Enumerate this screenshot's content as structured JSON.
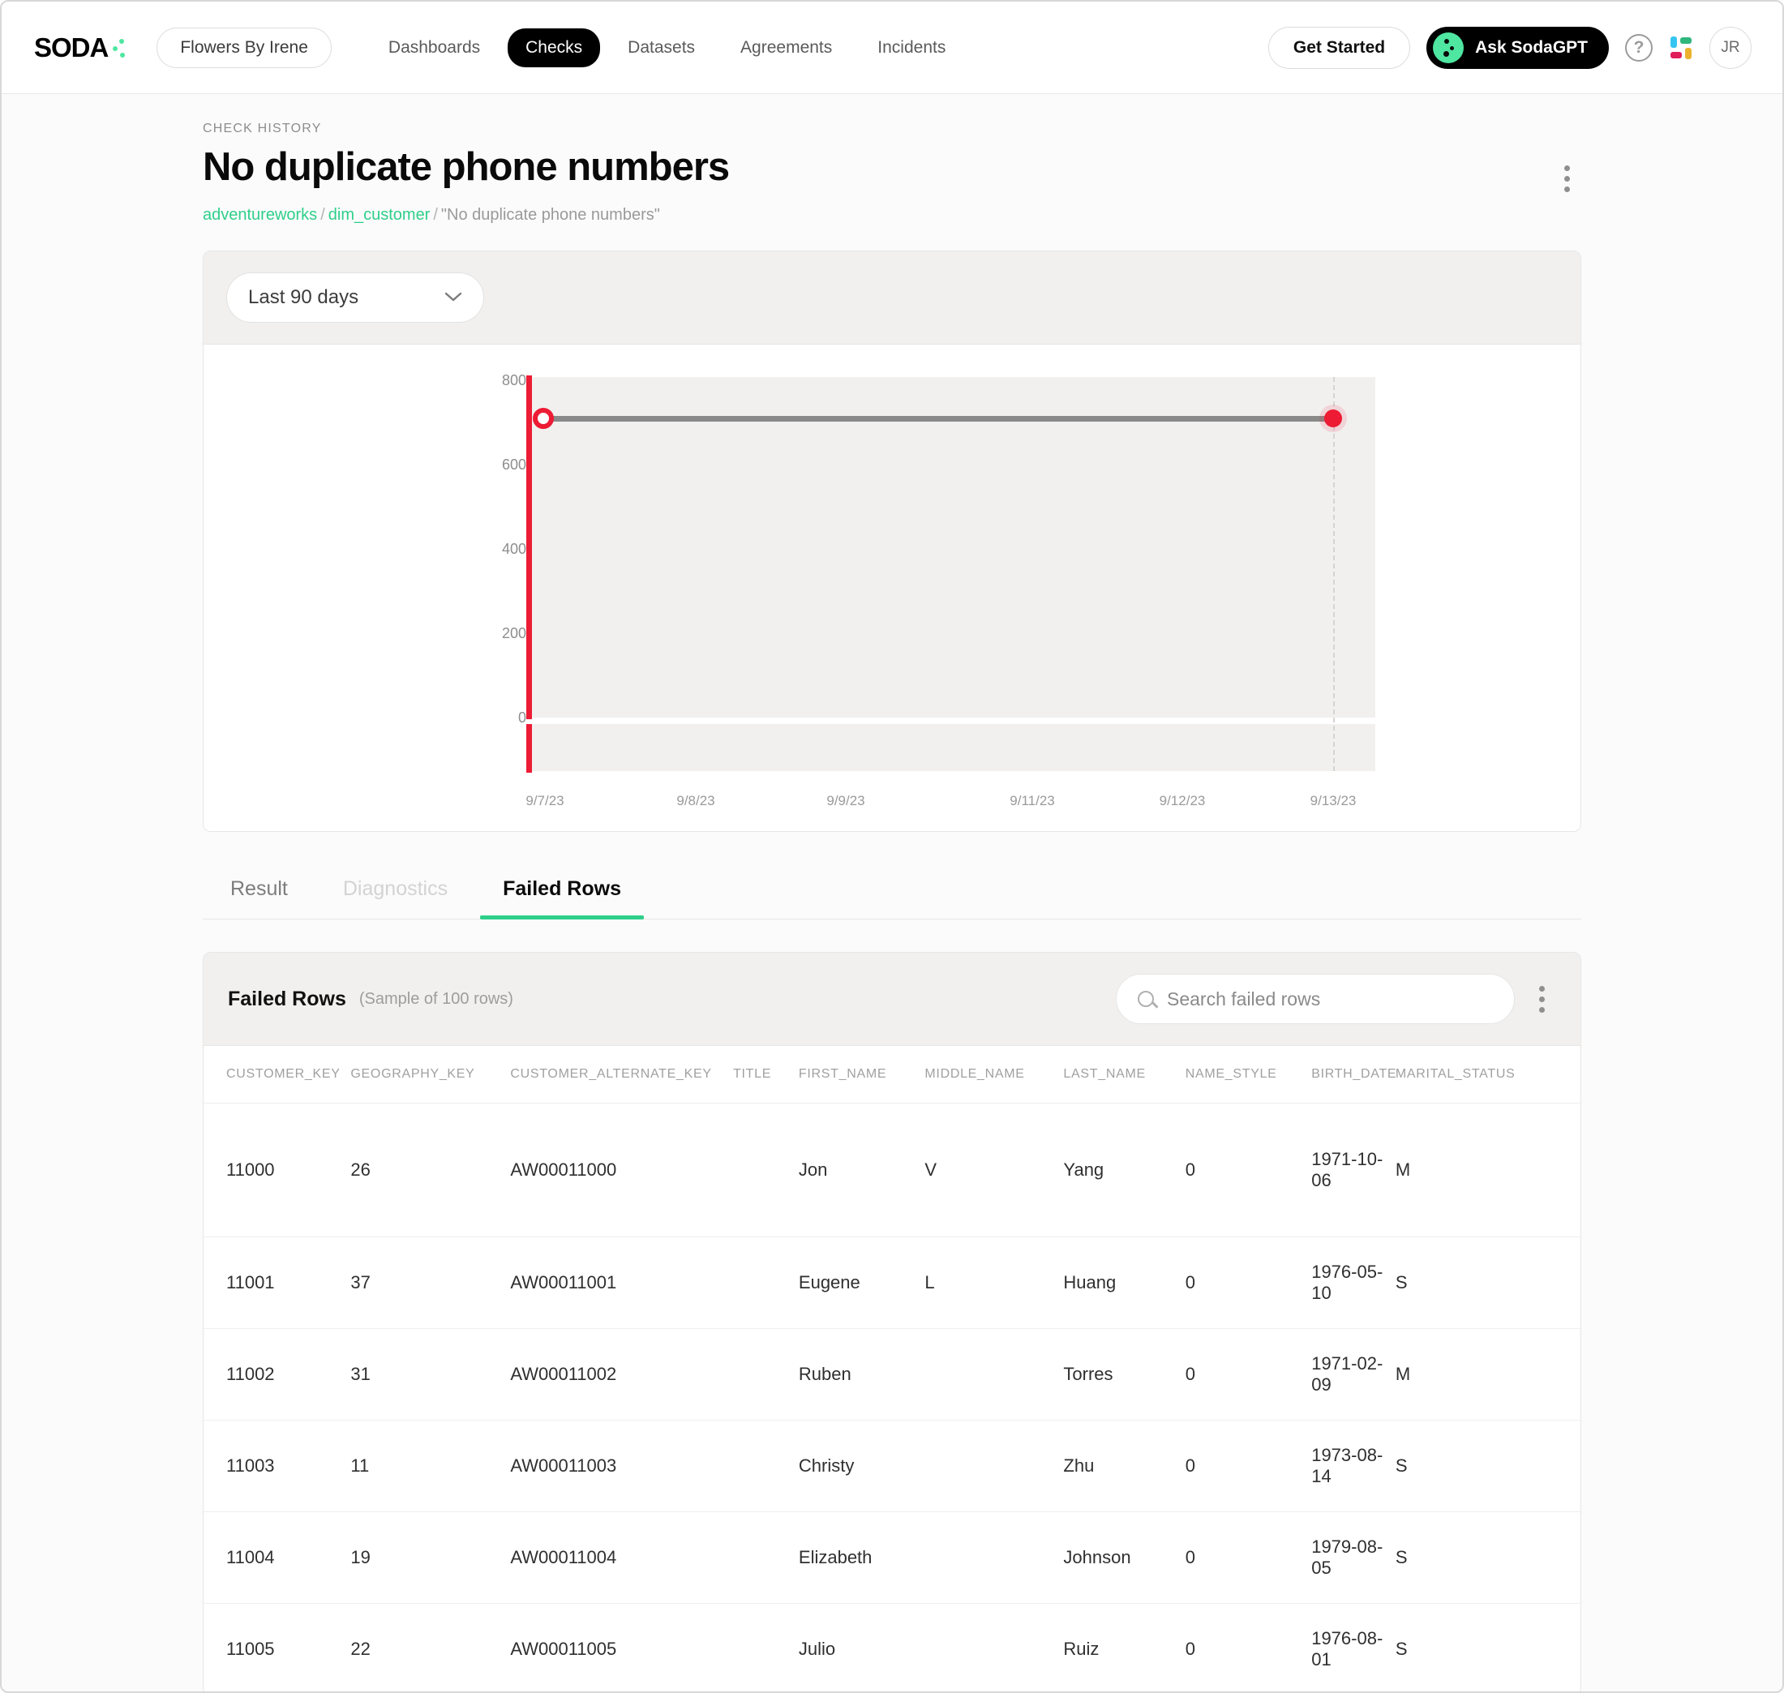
{
  "header": {
    "logo_text": "SODA",
    "org_name": "Flowers By Irene",
    "nav": [
      {
        "label": "Dashboards",
        "active": false
      },
      {
        "label": "Checks",
        "active": true
      },
      {
        "label": "Datasets",
        "active": false
      },
      {
        "label": "Agreements",
        "active": false
      },
      {
        "label": "Incidents",
        "active": false
      }
    ],
    "get_started_label": "Get Started",
    "sodagpt_label": "Ask SodaGPT",
    "help_glyph": "?",
    "avatar_initials": "JR"
  },
  "page": {
    "eyebrow": "CHECK HISTORY",
    "title": "No duplicate phone numbers",
    "breadcrumb": {
      "dataset": "adventureworks",
      "table": "dim_customer",
      "check": "\"No duplicate phone numbers\"",
      "separator": "/"
    }
  },
  "chart_panel": {
    "range_value": "Last 90 days",
    "chevron": "⌄"
  },
  "chart_data": {
    "type": "line",
    "title": "",
    "xlabel": "",
    "ylabel": "",
    "x": [
      "9/7/23",
      "9/8/23",
      "9/9/23",
      "9/11/23",
      "9/12/23",
      "9/13/23"
    ],
    "tick_labels_x": [
      "9/7/23",
      "9/8/23",
      "9/9/23",
      "9/11/23",
      "9/12/23",
      "9/13/23"
    ],
    "tick_labels_y": [
      "0",
      "200",
      "400",
      "600",
      "800"
    ],
    "ylim": [
      0,
      880
    ],
    "grid": false,
    "series": [
      {
        "name": "Failed rows",
        "values": [
          710,
          710,
          710,
          710,
          710,
          710
        ],
        "color": "#8a8a8a",
        "marker_first": "open-circle",
        "marker_last": "filled-circle",
        "marker_color": "#ed1b34"
      }
    ],
    "axis_color": "#ed1b34",
    "legend": []
  },
  "tabs": [
    {
      "label": "Result",
      "state": "inactive"
    },
    {
      "label": "Diagnostics",
      "state": "disabled"
    },
    {
      "label": "Failed Rows",
      "state": "active"
    }
  ],
  "failed_rows": {
    "title": "Failed Rows",
    "subtitle": "(Sample of 100 rows)",
    "search_placeholder": "Search failed rows",
    "search_value": "",
    "columns": [
      "CUSTOMER_KEY",
      "GEOGRAPHY_KEY",
      "CUSTOMER_ALTERNATE_KEY",
      "TITLE",
      "FIRST_NAME",
      "MIDDLE_NAME",
      "LAST_NAME",
      "NAME_STYLE",
      "BIRTH_DATE",
      "MARITAL_STATUS"
    ],
    "rows": [
      [
        "11000",
        "26",
        "AW00011000",
        "",
        "Jon",
        "V",
        "Yang",
        "0",
        "1971-10-06",
        "M"
      ],
      [
        "11001",
        "37",
        "AW00011001",
        "",
        "Eugene",
        "L",
        "Huang",
        "0",
        "1976-05-10",
        "S"
      ],
      [
        "11002",
        "31",
        "AW00011002",
        "",
        "Ruben",
        "",
        "Torres",
        "0",
        "1971-02-09",
        "M"
      ],
      [
        "11003",
        "11",
        "AW00011003",
        "",
        "Christy",
        "",
        "Zhu",
        "0",
        "1973-08-14",
        "S"
      ],
      [
        "11004",
        "19",
        "AW00011004",
        "",
        "Elizabeth",
        "",
        "Johnson",
        "0",
        "1979-08-05",
        "S"
      ],
      [
        "11005",
        "22",
        "AW00011005",
        "",
        "Julio",
        "",
        "Ruiz",
        "0",
        "1976-08-01",
        "S"
      ]
    ]
  },
  "colors": {
    "accent_green": "#2fcf8a",
    "alert_red": "#ed1b34",
    "panel_gray": "#f1f0ef",
    "black": "#000000"
  }
}
